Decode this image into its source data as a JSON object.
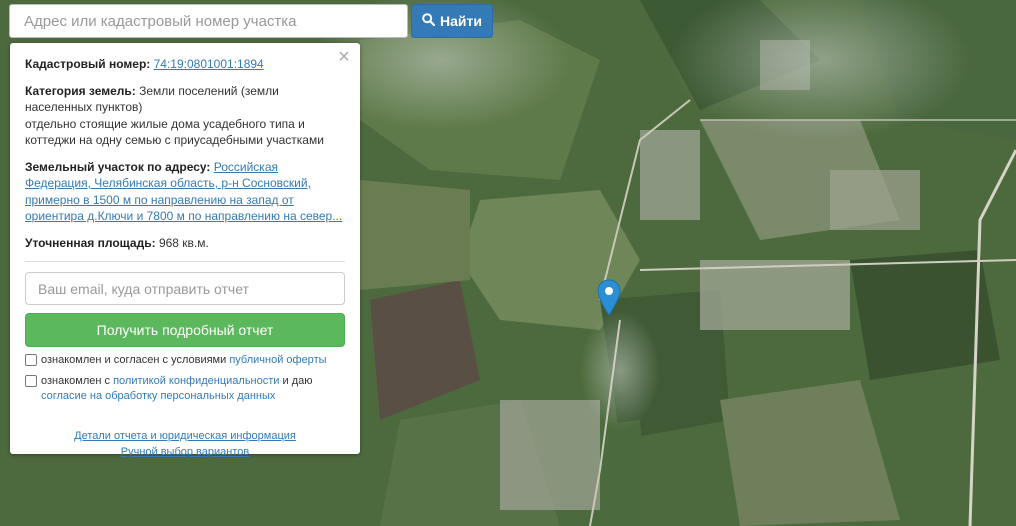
{
  "search": {
    "placeholder": "Адрес или кадастровый номер участка",
    "button_label": "Найти",
    "button_icon": "search-icon"
  },
  "panel": {
    "close_icon": "×",
    "cadastral_label": "Кадастровый номер:",
    "cadastral_value": "74:19:0801001:1894",
    "category_label": "Категория земель:",
    "category_value": "Земли поселений (земли населенных пунктов)",
    "category_detail": "отдельно стоящие жилые дома усадебного типа и коттеджи на одну семью с приусадебными участками",
    "address_label": "Земельный участок по адресу:",
    "address_value": "Российская Федерация, Челябинская область, р-н Сосновский, примерно в 1500 м по направлению на запад от ориентира д.Ключи и 7800 м по направлению на север...",
    "area_label": "Уточненная площадь:",
    "area_value": "968 кв.м.",
    "email_placeholder": "Ваш email, куда отправить отчет",
    "report_button": "Получить подробный отчет",
    "offer_text": "ознакомлен и согласен с условиями",
    "offer_link": "публичной оферты",
    "privacy_text_before": "ознакомлен с",
    "privacy_link": "политикой конфиденциальности",
    "privacy_text_after": "и даю",
    "consent_link": "согласие на обработку персональных данных",
    "details_link": "Детали отчета и юридическая информация",
    "manual_link": "Ручной выбор вариантов"
  },
  "colors": {
    "primary": "#337ab7",
    "success": "#5cb85c",
    "marker": "#2b8fd6"
  },
  "map": {
    "marker_icon": "map-pin-icon"
  }
}
